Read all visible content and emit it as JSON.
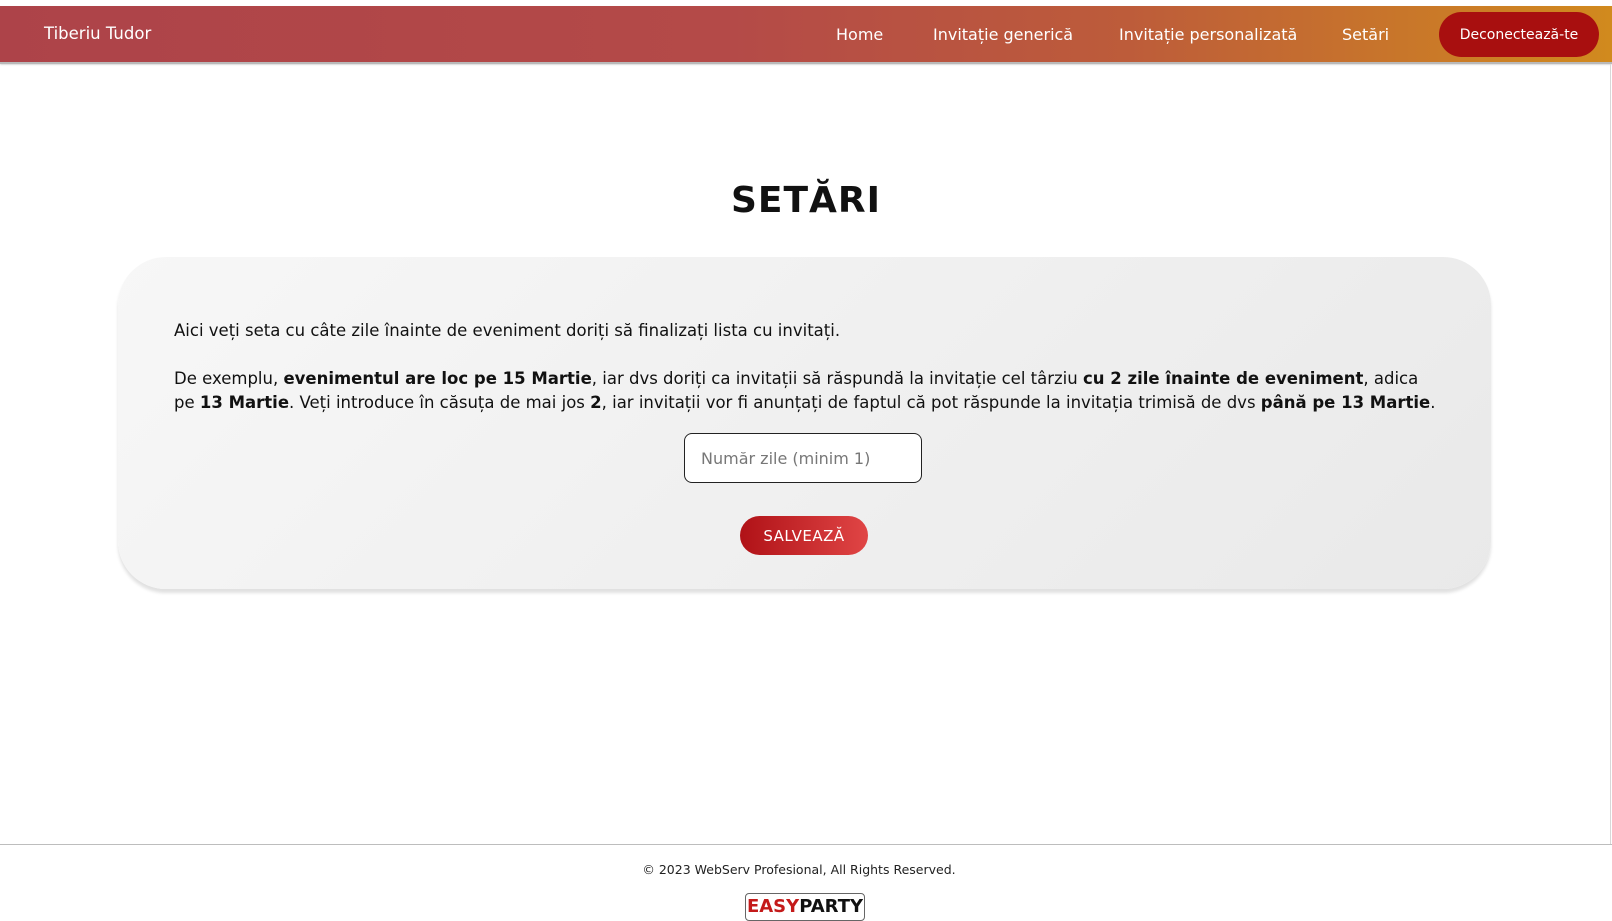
{
  "navbar": {
    "brand": "Tiberiu Tudor",
    "items": [
      "Home",
      "Invitație generică",
      "Invitație personalizată",
      "Setări"
    ],
    "logout_label": "Deconectează-te"
  },
  "main": {
    "title": "SETĂRI",
    "intro": "Aici veți seta cu câte zile înainte de eveniment doriți să finalizați lista cu invitați.",
    "example": {
      "t1": "De exemplu, ",
      "b1": "evenimentul are loc pe 15 Martie",
      "t2": ", iar dvs doriți ca invitații să răspundă la invitație cel târziu ",
      "b2": "cu 2 zile înainte de eveniment",
      "t3": ", adica pe ",
      "b3": "13 Martie",
      "t4": ". Veți introduce în căsuța de mai jos ",
      "b4": "2",
      "t5": ", iar invitații vor fi anunțați de faptul că pot răspunde la invitația trimisă de dvs ",
      "b5": "până pe 13 Martie",
      "t6": "."
    },
    "days_input": {
      "placeholder": "Număr zile (minim 1)",
      "value": ""
    },
    "save_label": "SALVEAZĂ"
  },
  "footer": {
    "copyright": "© 2023 WebServ Profesional, All Rights Reserved.",
    "logo_part1": "EASY",
    "logo_part2": "PARTY"
  },
  "colors": {
    "nav_gradient_start": "#ad4349",
    "nav_gradient_end": "#d18a1e",
    "logout_bg": "#a80f0f",
    "save_gradient_start": "#b01217",
    "save_gradient_end": "#e04545"
  }
}
